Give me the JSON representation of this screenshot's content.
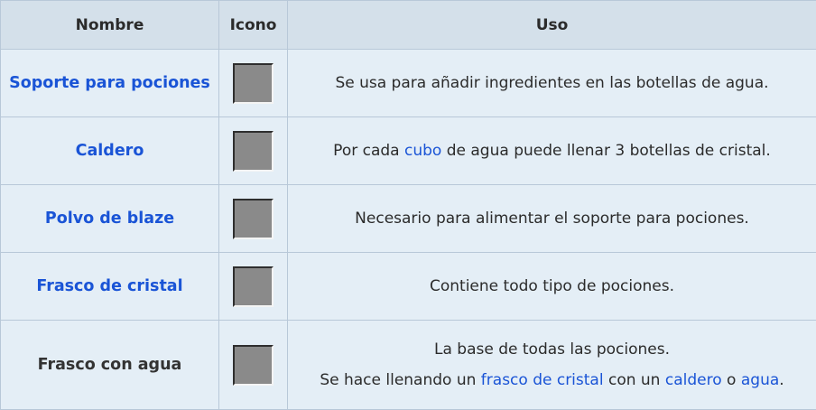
{
  "headers": {
    "name": "Nombre",
    "icon": "Icono",
    "use": "Uso"
  },
  "rows": [
    {
      "name": "Soporte para pociones",
      "icon": "brewing-stand-icon",
      "use": "Se usa para añadir ingredientes en las botellas de agua."
    },
    {
      "name": "Caldero",
      "icon": "cauldron-icon",
      "use_pre": "Por cada ",
      "use_link": "cubo",
      "use_post": " de agua puede llenar 3 botellas de cristal."
    },
    {
      "name": "Polvo de blaze",
      "icon": "blaze-powder-icon",
      "use": "Necesario para alimentar el soporte para pociones."
    },
    {
      "name": "Frasco de cristal",
      "icon": "glass-bottle-icon",
      "use": "Contiene todo tipo de pociones."
    },
    {
      "name": "Frasco con agua",
      "icon": "water-bottle-icon",
      "use_line1": "La base de todas las pociones.",
      "use_line2": {
        "t1": "Se hace llenando un ",
        "link1": "frasco de cristal",
        "t2": " con un ",
        "link2": "caldero",
        "t3": " o ",
        "link3": "agua",
        "t4": "."
      }
    }
  ],
  "colors": {
    "link": "#1a54d6",
    "header_bg": "#d4e0ea",
    "cell_bg": "#e4eef6"
  }
}
